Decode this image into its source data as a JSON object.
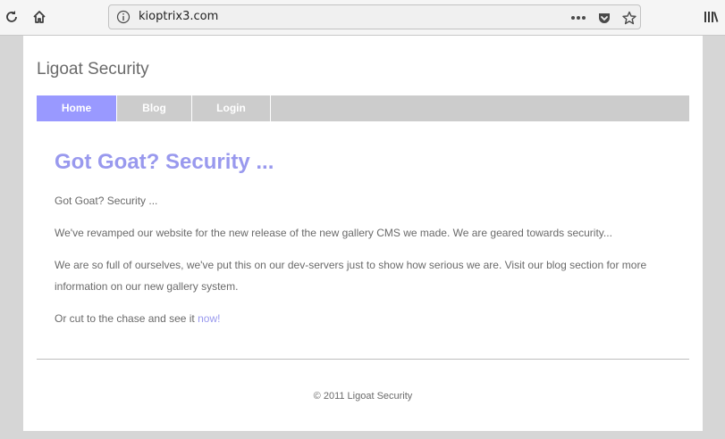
{
  "browser": {
    "url": "kioptrix3.com",
    "icons": {
      "reload": "reload-icon",
      "home": "home-icon",
      "info": "info-icon",
      "page_actions": "more-dots-icon",
      "pocket": "pocket-icon",
      "bookmark": "star-icon",
      "library": "library-icon"
    }
  },
  "site": {
    "title": "Ligoat Security",
    "nav": [
      {
        "label": "Home",
        "active": true
      },
      {
        "label": "Blog",
        "active": false
      },
      {
        "label": "Login",
        "active": false
      }
    ],
    "heading": "Got Goat? Security ...",
    "paragraphs": {
      "p1": "Got Goat? Security ...",
      "p2": "We've revamped our website for the new release of the new gallery CMS we made. We are geared towards security...",
      "p3": "We are so full of ourselves, we've put this on our dev-servers just to show how serious we are. Visit our blog section for more information on our new gallery system.",
      "p4_prefix": "Or cut to the chase and see it ",
      "p4_link": "now!"
    },
    "footer": "© 2011 Ligoat Security",
    "colors": {
      "accent": "#9999ff",
      "nav_bg": "#cccccc",
      "text": "#6a6a6a"
    }
  }
}
